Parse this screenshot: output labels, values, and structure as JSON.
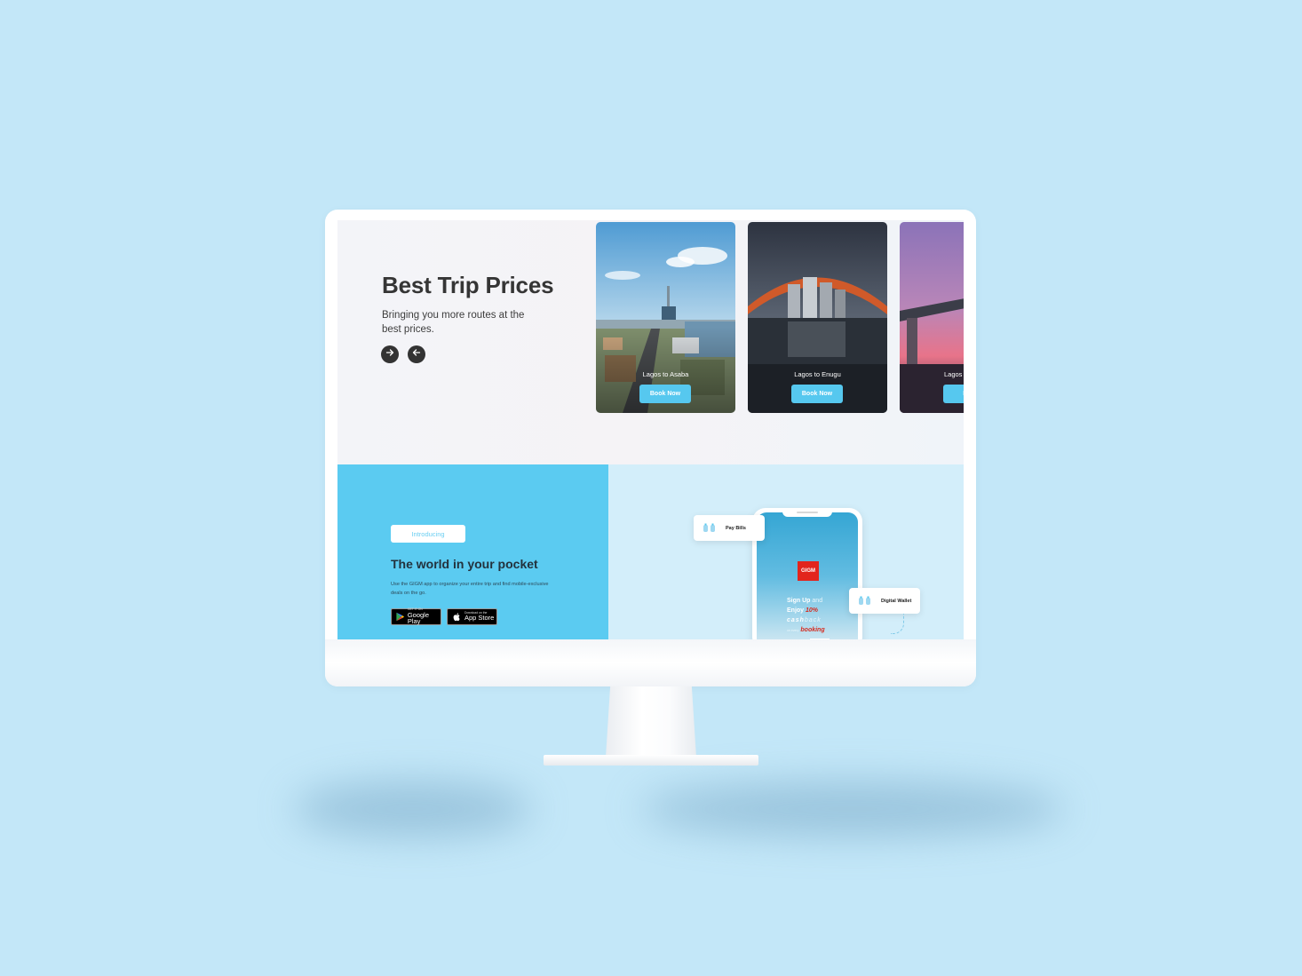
{
  "hero": {
    "title": "Best Trip Prices",
    "subtitle": "Bringing you more routes at the best prices.",
    "next_icon": "arrow-right-icon",
    "prev_icon": "arrow-left-icon"
  },
  "routes": [
    {
      "label": "Lagos to Asaba",
      "button": "Book Now"
    },
    {
      "label": "Lagos to Enugu",
      "button": "Book Now"
    },
    {
      "label": "Lagos",
      "button": "Boo"
    }
  ],
  "app_promo": {
    "badge": "Introducing",
    "title": "The world in your pocket",
    "description": "Use the GIGM app to organize your entire trip and find mobile-exclusive deals on the go.",
    "google_play": {
      "small": "GET IT ON",
      "big": "Google Play",
      "icon": "google-play-icon"
    },
    "app_store": {
      "small": "Download on the",
      "big": "App Store",
      "icon": "apple-icon"
    }
  },
  "phone": {
    "logo": "GIGM",
    "promo_signup": "Sign Up",
    "promo_and": "and",
    "promo_enjoy": "Enjoy",
    "promo_percent": "10%",
    "promo_cash": "cash",
    "promo_back": "back",
    "promo_on": "on every",
    "promo_booking": "booking"
  },
  "chips": {
    "pay_bills": "Pay Bills",
    "digital_wallet": "Digital Wallet",
    "icon": "wallet-icon"
  },
  "colors": {
    "background": "#c3e7f8",
    "accent": "#56c8ef",
    "app_panel": "#5bcbf1",
    "brand_red": "#e2251d",
    "dark_text": "#353535"
  }
}
